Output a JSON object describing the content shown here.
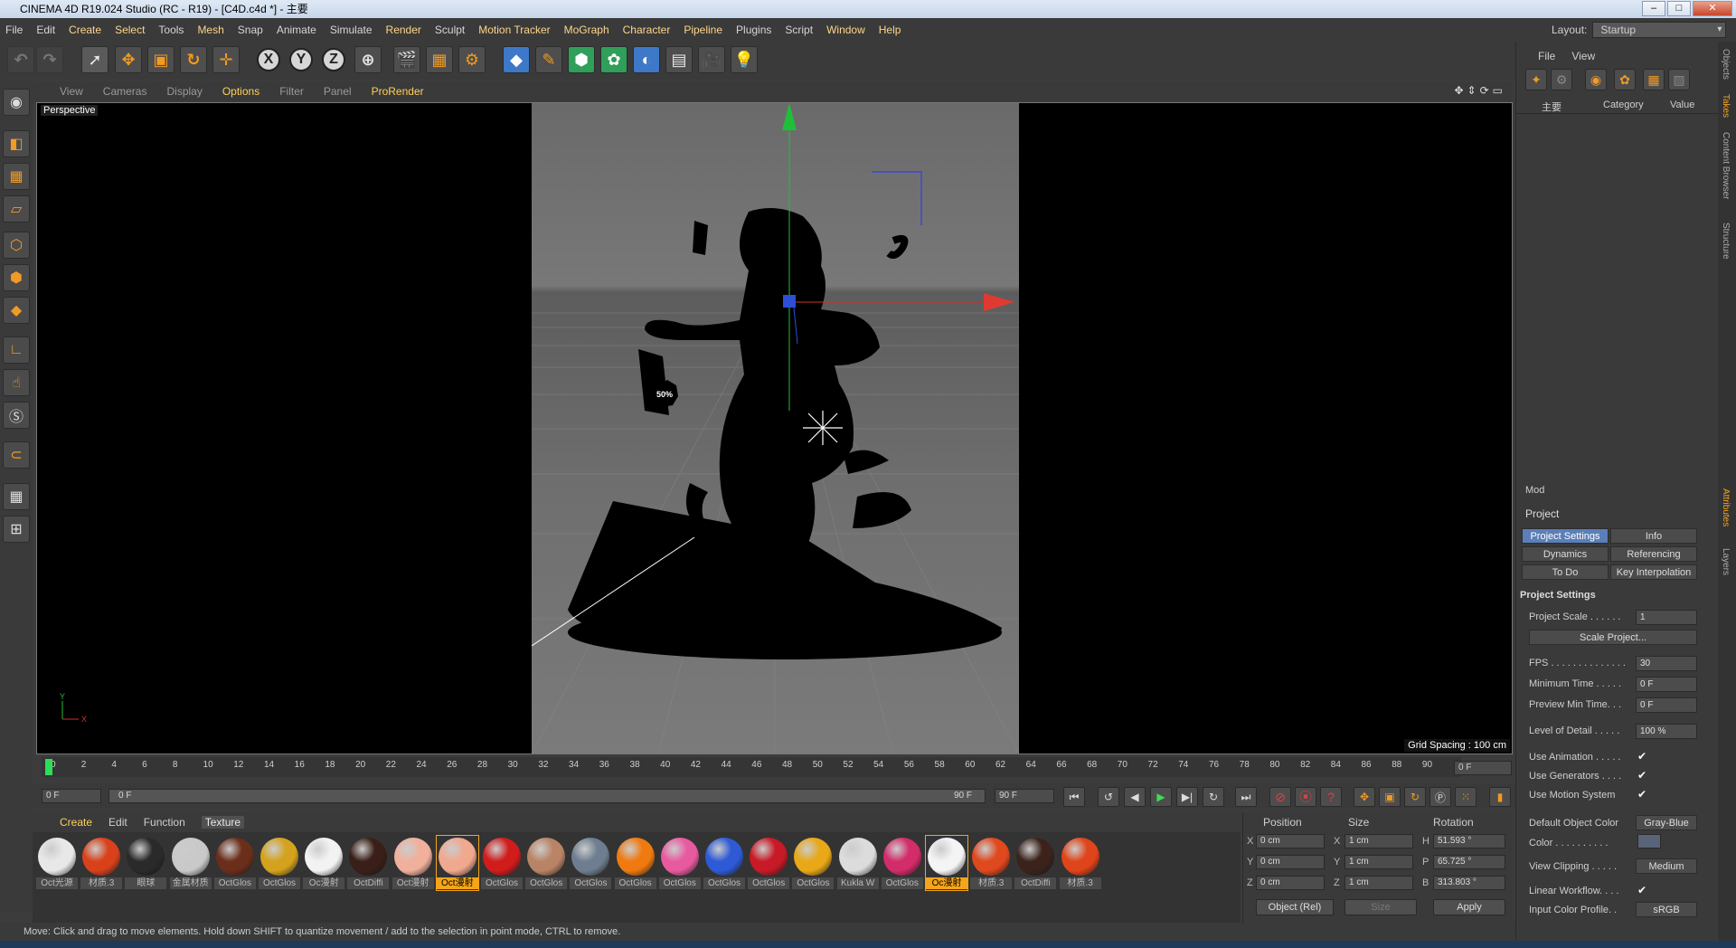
{
  "window": {
    "title": "CINEMA 4D R19.024 Studio (RC - R19) - [C4D.c4d *] - 主要"
  },
  "menu": [
    "File",
    "Edit",
    "Create",
    "Select",
    "Tools",
    "Mesh",
    "Snap",
    "Animate",
    "Simulate",
    "Render",
    "Sculpt",
    "Motion Tracker",
    "MoGraph",
    "Character",
    "Pipeline",
    "Plugins",
    "Script",
    "Window",
    "Help"
  ],
  "layout": {
    "label": "Layout:",
    "value": "Startup"
  },
  "viewport": {
    "menu": [
      "View",
      "Cameras",
      "Display",
      "Options",
      "Filter",
      "Panel",
      "ProRender"
    ],
    "label": "Perspective",
    "grid_spacing": "Grid Spacing : 100 cm",
    "badge_text": "50%",
    "axis_y": "Y",
    "axis_x": "X"
  },
  "timeline": {
    "ticks": [
      "0",
      "2",
      "4",
      "6",
      "8",
      "10",
      "12",
      "14",
      "16",
      "18",
      "20",
      "22",
      "24",
      "26",
      "28",
      "30",
      "32",
      "34",
      "36",
      "38",
      "40",
      "42",
      "44",
      "46",
      "48",
      "50",
      "52",
      "54",
      "56",
      "58",
      "60",
      "62",
      "64",
      "66",
      "68",
      "70",
      "72",
      "74",
      "76",
      "78",
      "80",
      "82",
      "84",
      "86",
      "88",
      "90"
    ],
    "current_frame": "0 F",
    "start_frame": "0 F",
    "range_start": "0 F",
    "range_end": "90 F",
    "end_frame": "90 F"
  },
  "materials_menu": [
    "Create",
    "Edit",
    "Function",
    "Texture"
  ],
  "materials": [
    {
      "label": "Oct光源",
      "color": "#e8e8e8"
    },
    {
      "label": "材质.3",
      "color": "#d9411b"
    },
    {
      "label": "眼球",
      "color": "#2a2a2a"
    },
    {
      "label": "金属材质",
      "color": "#c9c9c9"
    },
    {
      "label": "OctGlos",
      "color": "#6b2e1a"
    },
    {
      "label": "OctGlos",
      "color": "#d4a21c"
    },
    {
      "label": "Oc漫射",
      "color": "#f2f2f2"
    },
    {
      "label": "OctDiffi",
      "color": "#3a1f18"
    },
    {
      "label": "Oct漫射",
      "color": "#f0b09c"
    },
    {
      "label": "Oct漫射",
      "color": "#f0a88e"
    },
    {
      "label": "OctGlos",
      "color": "#d11c1c"
    },
    {
      "label": "OctGlos",
      "color": "#b98466"
    },
    {
      "label": "OctGlos",
      "color": "#6e7e90"
    },
    {
      "label": "OctGlos",
      "color": "#f07a10"
    },
    {
      "label": "OctGlos",
      "color": "#e85aa0"
    },
    {
      "label": "OctGlos",
      "color": "#2e5ad6"
    },
    {
      "label": "OctGlos",
      "color": "#c81a26"
    },
    {
      "label": "OctGlos",
      "color": "#e8a818"
    },
    {
      "label": "Kukla W",
      "color": "#dcdcdc"
    },
    {
      "label": "OctGlos",
      "color": "#d32c6a"
    },
    {
      "label": "Oc漫射",
      "color": "#f4f4f4"
    },
    {
      "label": "材质.3",
      "color": "#e0481e"
    },
    {
      "label": "OctDiffi",
      "color": "#3b231c"
    },
    {
      "label": "材质.3",
      "color": "#e0441a"
    }
  ],
  "coords": {
    "headers": [
      "Position",
      "Size",
      "Rotation"
    ],
    "rows": [
      {
        "axis": "X",
        "pos": "0 cm",
        "size_axis": "X",
        "size": "1 cm",
        "rot_axis": "H",
        "rot": "51.593 °"
      },
      {
        "axis": "Y",
        "pos": "0 cm",
        "size_axis": "Y",
        "size": "1 cm",
        "rot_axis": "P",
        "rot": "65.725 °"
      },
      {
        "axis": "Z",
        "pos": "0 cm",
        "size_axis": "Z",
        "size": "1 cm",
        "rot_axis": "B",
        "rot": "313.803 °"
      }
    ],
    "mode": "Object (Rel)",
    "size_mode": "Size",
    "apply": "Apply"
  },
  "status": "Move: Click and drag to move elements. Hold down SHIFT to quantize movement / add to the selection in point mode, CTRL to remove.",
  "object_manager": {
    "menu": [
      "File",
      "View"
    ],
    "columns": [
      "主要",
      "Category",
      "Value"
    ]
  },
  "side_tabs": [
    "Objects",
    "Takes",
    "Content Browser",
    "Structure",
    "Attributes",
    "Layers"
  ],
  "attributes": {
    "mode": "Mod",
    "object": "Project",
    "tabs": [
      {
        "label": "Project Settings",
        "active": true
      },
      {
        "label": "Info",
        "active": false
      },
      {
        "label": "Dynamics",
        "active": false
      },
      {
        "label": "Referencing",
        "active": false
      },
      {
        "label": "To Do",
        "active": false
      },
      {
        "label": "Key Interpolation",
        "active": false
      }
    ],
    "section": "Project Settings",
    "project_scale_label": "Project Scale . . . . . .",
    "project_scale": "1",
    "scale_button": "Scale Project...",
    "fps_label": "FPS . . . . . . . . . . . . . .",
    "fps": "30",
    "min_time_label": "Minimum Time . . . . .",
    "min_time": "0 F",
    "preview_min_label": "Preview Min Time. . .",
    "preview_min": "0 F",
    "lod_label": "Level of Detail . . . . .",
    "lod": "100 %",
    "use_animation": "Use Animation . . . . .",
    "use_generators": "Use Generators . . . .",
    "use_motion": "Use Motion System",
    "check": "✔",
    "default_color_label": "Default Object Color",
    "default_color": "Gray-Blue",
    "color_label": "Color . . . . . . . . . .",
    "view_clipping_label": "View Clipping . . . . .",
    "view_clipping": "Medium",
    "linear_workflow": "Linear Workflow. . . .",
    "input_profile_label": "Input Color Profile. .",
    "input_profile": "sRGB"
  }
}
